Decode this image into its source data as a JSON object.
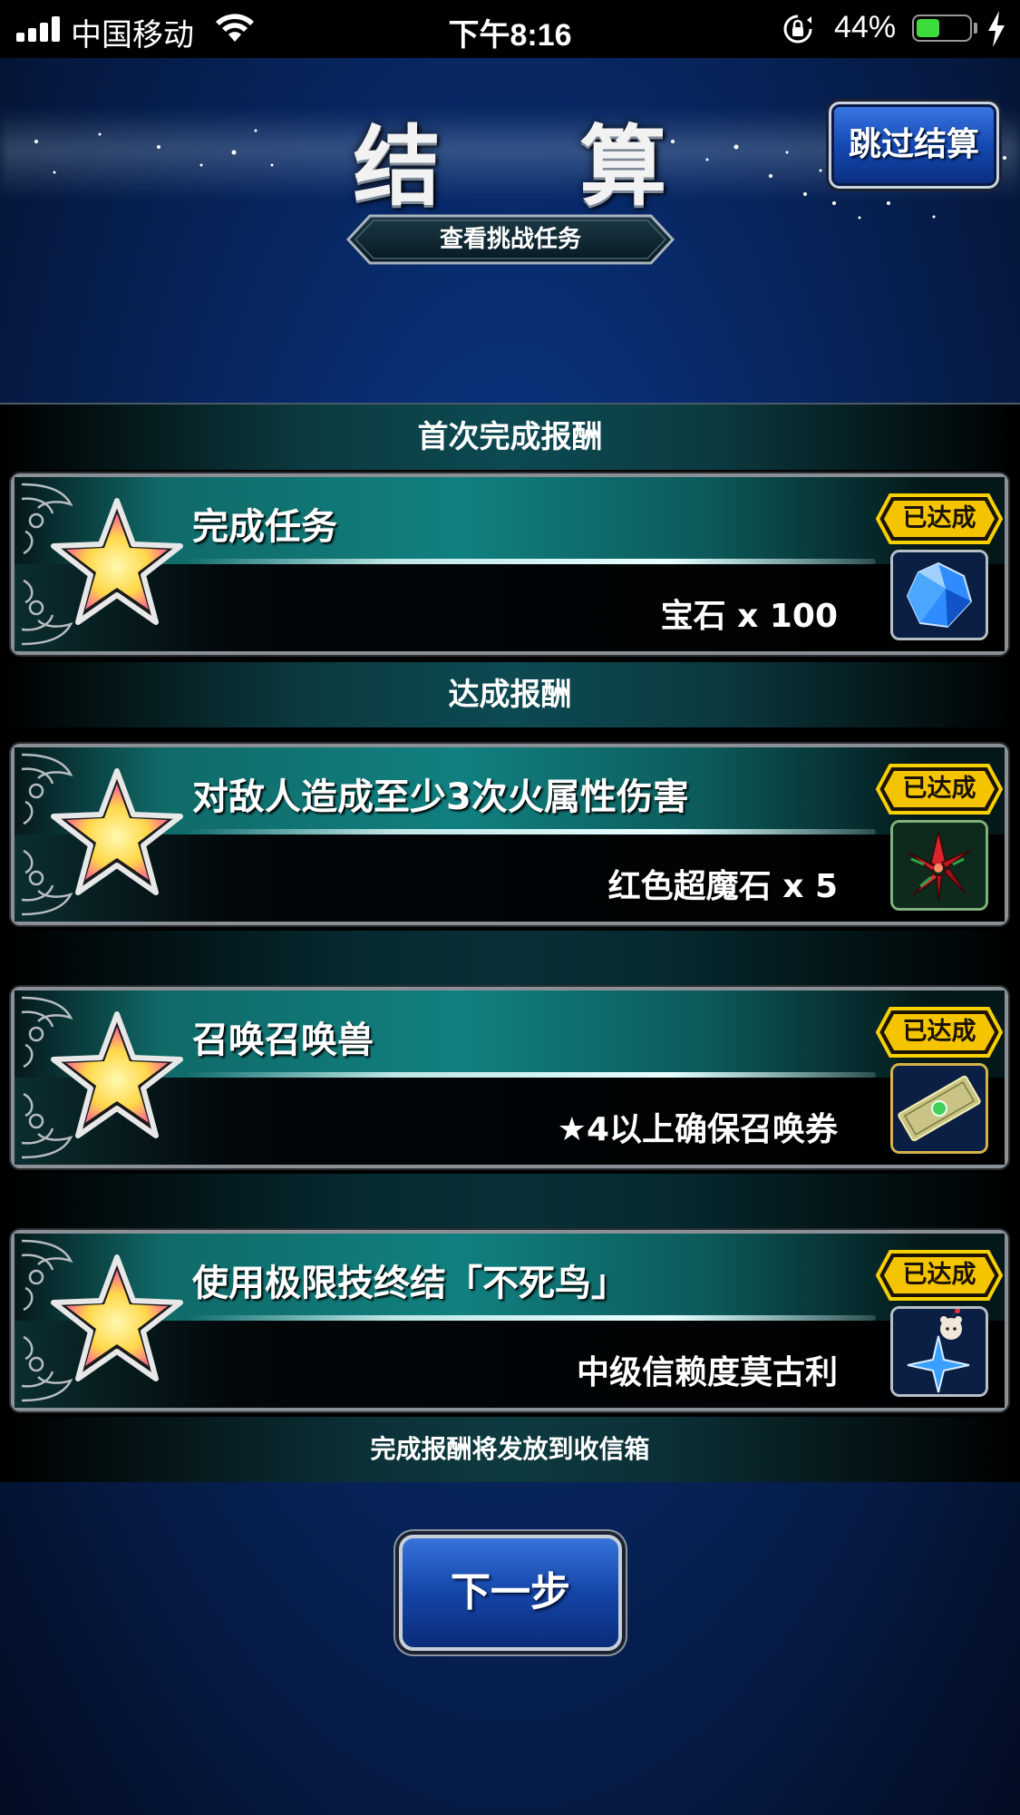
{
  "status_bar": {
    "carrier": "中国移动",
    "time": "下午8:16",
    "battery_percent": "44%",
    "battery_level": 0.44,
    "icons": [
      "signal-icon",
      "wifi-icon",
      "rotation-lock-icon",
      "battery-icon",
      "charging-icon"
    ]
  },
  "header": {
    "title": "结 算",
    "skip_label": "跳过结算",
    "challenge_label": "查看挑战任务"
  },
  "sections": {
    "first_clear": "首次完成报酬",
    "achievement": "达成报酬",
    "footer_note": "完成报酬将发放到收信箱"
  },
  "tasks": [
    {
      "title": "完成任务",
      "reward": "宝石 x 100",
      "status": "已达成",
      "item_icon": "gem-icon"
    },
    {
      "title": "对敌人造成至少3次火属性伤害",
      "reward": "红色超魔石 x 5",
      "status": "已达成",
      "item_icon": "red-crystal-icon"
    },
    {
      "title": "召唤召唤兽",
      "reward": "★4以上确保召唤券",
      "status": "已达成",
      "item_icon": "summon-ticket-icon"
    },
    {
      "title": "使用极限技终结「不死鸟」",
      "reward": "中级信赖度莫古利",
      "status": "已达成",
      "item_icon": "moogle-icon"
    }
  ],
  "next_label": "下一步",
  "colors": {
    "background_blue": "#082a6a",
    "card_teal": "#118080",
    "badge_gold": "#f5c400",
    "button_blue": "#1545a8"
  }
}
